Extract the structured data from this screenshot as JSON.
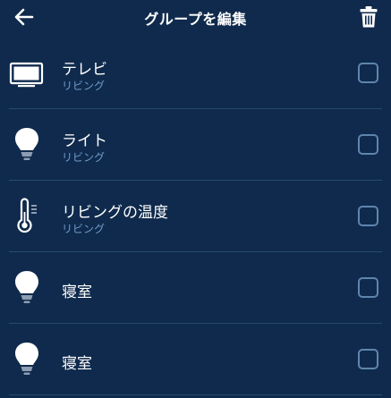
{
  "header": {
    "title": "グループを編集",
    "back_icon": "arrow-left-icon",
    "delete_icon": "trash-icon"
  },
  "devices": [
    {
      "name": "テレビ",
      "room": "リビング",
      "icon": "tv-icon",
      "checked": false
    },
    {
      "name": "ライト",
      "room": "リビング",
      "icon": "lightbulb-icon",
      "checked": false
    },
    {
      "name": "リビングの温度",
      "room": "リビング",
      "icon": "thermometer-icon",
      "checked": false
    },
    {
      "name": "寝室",
      "room": "",
      "icon": "lightbulb-icon",
      "checked": false
    },
    {
      "name": "寝室",
      "room": "",
      "icon": "lightbulb-icon",
      "checked": false
    }
  ],
  "colors": {
    "background": "#0f2a4c",
    "divider": "#284a70",
    "subtext": "#6f9cc9",
    "checkbox_border": "#5f85ad"
  }
}
